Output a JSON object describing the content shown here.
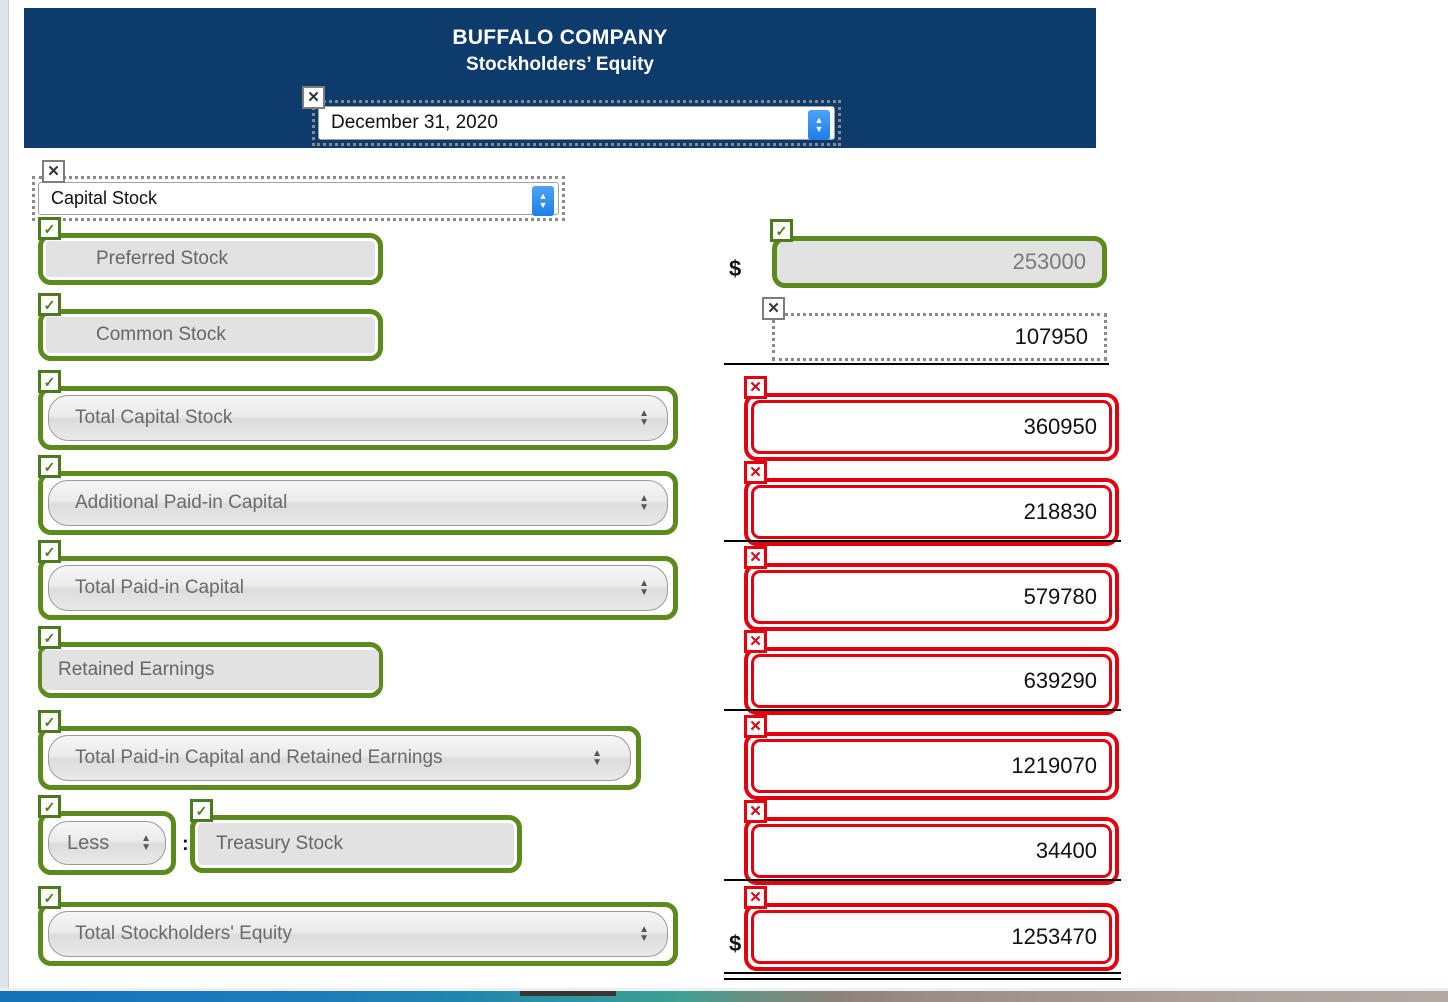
{
  "statement": {
    "company": "BUFFALO COMPANY",
    "title": "Stockholders’ Equity",
    "date_value": "December 31, 2020",
    "section_value": "Capital Stock"
  },
  "icons": {
    "check": "✓",
    "x": "✕",
    "stepper_up": "▲",
    "stepper_down": "▼",
    "select_up": "▲",
    "select_down": "▼",
    "date_stepper": "⌃⌄"
  },
  "symbols": {
    "dollar": "$",
    "colon": ":"
  },
  "rows": [
    {
      "label": "Preferred Stock",
      "label_kind": "text",
      "label_status": "correct",
      "value": "253000",
      "value_status": "correct",
      "value_kind": "locked",
      "dollar": true,
      "rule": "none"
    },
    {
      "label": "Common Stock",
      "label_kind": "text",
      "label_status": "correct",
      "value": "107950",
      "value_status": "editable",
      "value_kind": "input",
      "dollar": false,
      "rule": "single"
    },
    {
      "label": "Total Capital Stock",
      "label_kind": "select",
      "label_status": "correct",
      "value": "360950",
      "value_status": "incorrect",
      "value_kind": "input",
      "dollar": false,
      "rule": "none"
    },
    {
      "label": "Additional Paid-in Capital",
      "label_kind": "select",
      "label_status": "correct",
      "value": "218830",
      "value_status": "incorrect",
      "value_kind": "input",
      "dollar": false,
      "rule": "single"
    },
    {
      "label": "Total Paid-in Capital",
      "label_kind": "select",
      "label_status": "correct",
      "value": "579780",
      "value_status": "incorrect",
      "value_kind": "input",
      "dollar": false,
      "rule": "none"
    },
    {
      "label": "Retained Earnings",
      "label_kind": "text",
      "label_status": "correct",
      "value": "639290",
      "value_status": "incorrect",
      "value_kind": "input",
      "dollar": false,
      "rule": "single"
    },
    {
      "label": "Total Paid-in Capital and Retained Earnings",
      "label_kind": "select",
      "label_status": "correct",
      "value": "1219070",
      "value_status": "incorrect",
      "value_kind": "input",
      "dollar": false,
      "rule": "none"
    },
    {
      "label": "Treasury Stock",
      "prefix_select": "Less",
      "label_kind": "text",
      "label_status": "correct",
      "value": "34400",
      "value_status": "incorrect",
      "value_kind": "input",
      "dollar": false,
      "rule": "single"
    },
    {
      "label": "Total Stockholders' Equity",
      "label_kind": "select",
      "label_status": "correct",
      "value": "1253470",
      "value_status": "incorrect",
      "value_kind": "input",
      "dollar": true,
      "rule": "double"
    }
  ],
  "colors": {
    "banner": "#0d3b6b",
    "correct_green": "#5d8a1d",
    "incorrect_red": "#e3000f",
    "field_grey": "#e2e2e2",
    "accent_blue": "#1d7ee8"
  }
}
